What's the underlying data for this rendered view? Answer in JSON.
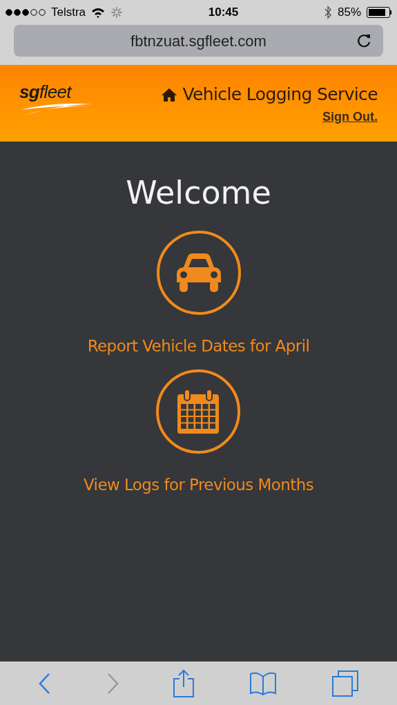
{
  "status_bar": {
    "carrier": "Telstra",
    "time": "10:45",
    "battery": "85%"
  },
  "address_bar": {
    "url": "fbtnzuat.sgfleet.com"
  },
  "header": {
    "logo": {
      "bold": "sg",
      "rest": "fleet"
    },
    "title": "Vehicle Logging Service",
    "sign_out": "Sign Out."
  },
  "main": {
    "heading": "Welcome",
    "actions": [
      {
        "kind": "car",
        "label": "Report Vehicle Dates for April"
      },
      {
        "kind": "calendar",
        "label": "View Logs for Previous Months"
      }
    ]
  },
  "toolbar": {
    "back_disabled": false,
    "forward_disabled": true
  }
}
